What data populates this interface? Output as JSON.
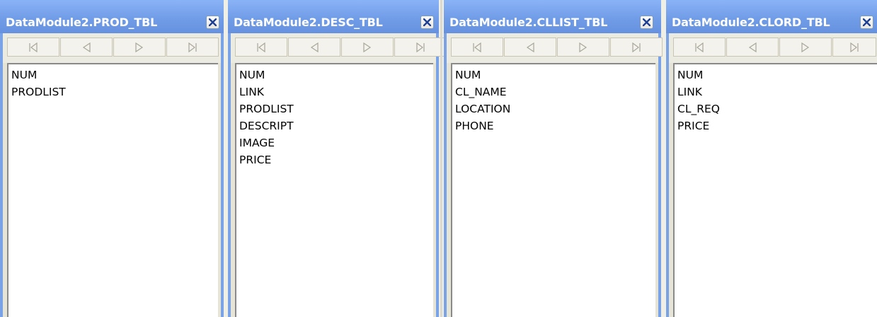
{
  "panels": [
    {
      "title": "DataModule2.PROD_TBL",
      "fields": [
        "NUM",
        "PRODLIST"
      ]
    },
    {
      "title": "DataModule2.DESC_TBL",
      "fields": [
        "NUM",
        "LINK",
        "PRODLIST",
        "DESCRIPT",
        "IMAGE",
        "PRICE"
      ]
    },
    {
      "title": "DataModule2.CLLIST_TBL",
      "fields": [
        "NUM",
        "CL_NAME",
        "LOCATION",
        "PHONE"
      ]
    },
    {
      "title": "DataModule2.CLORD_TBL",
      "fields": [
        "NUM",
        "LINK",
        "CL_REQ",
        "PRICE"
      ]
    }
  ],
  "icons": {
    "close": "close-x-icon",
    "first": "first-record-icon",
    "prior": "prior-record-icon",
    "next": "next-record-icon",
    "last": "last-record-icon"
  }
}
